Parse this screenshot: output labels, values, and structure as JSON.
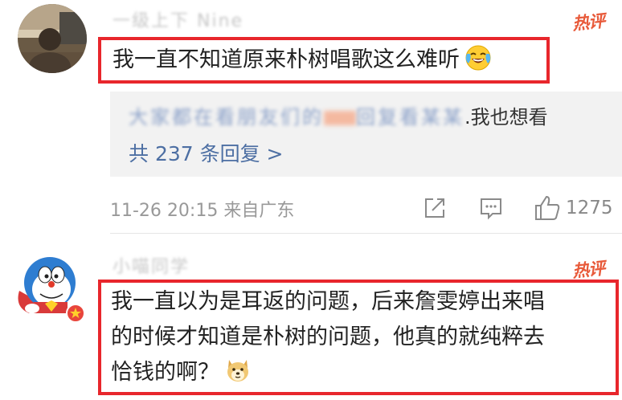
{
  "comments": [
    {
      "username": "一级上下 Nine",
      "hot_label": "热评",
      "text_lines": [
        "我一直不知道原来朴树唱歌这么难听"
      ],
      "emoji": "laughing-crying-icon",
      "reply_preview": {
        "blurred_name": "大家都在看朋友们的",
        "blurred_mid": "回复看某某",
        "suffix": ".我也想看"
      },
      "reply_count_label": "共 237 条回复 >",
      "timestamp": "11-26 20:15",
      "source": "来自广东",
      "likes": "1275"
    },
    {
      "username": "小喵同学",
      "hot_label": "热评",
      "text_lines": [
        "我一直以为是耳返的问题，后来詹雯婷出来唱",
        "的时候才知道是朴树的问题，他真的就纯粹去",
        "恰钱的啊？"
      ],
      "emoji": "doge-icon"
    }
  ],
  "colors": {
    "highlight_border": "#e8262c",
    "hot_label": "#e85a3a",
    "link_blue": "#4d6fa3",
    "reply_bg": "#f2f2f2"
  }
}
